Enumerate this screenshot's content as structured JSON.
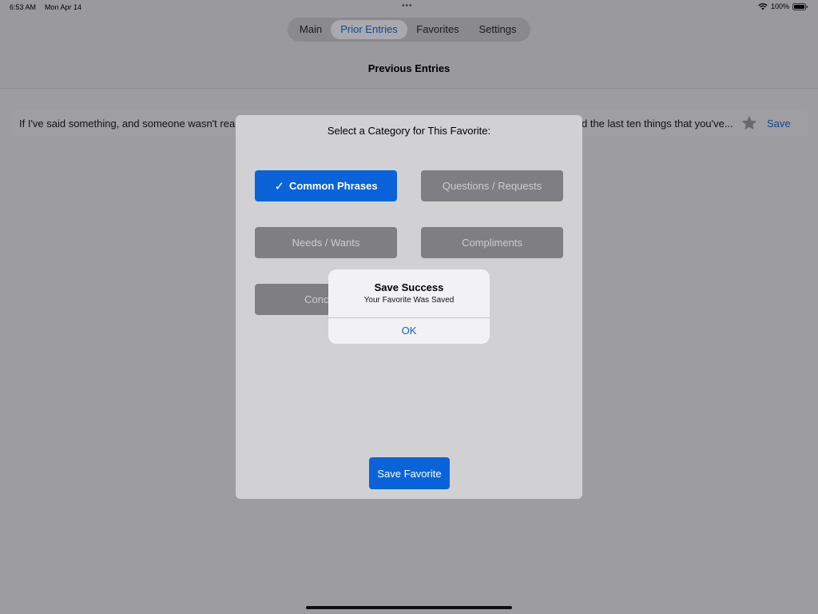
{
  "status_bar": {
    "time": "6:53 AM",
    "date": "Mon Apr 14",
    "dots": "•••",
    "battery": "100%",
    "icons": [
      "wifi-icon",
      "battery-icon"
    ]
  },
  "tabs": [
    {
      "label": "Main",
      "active": false
    },
    {
      "label": "Prior Entries",
      "active": true
    },
    {
      "label": "Favorites",
      "active": false
    },
    {
      "label": "Settings",
      "active": false
    }
  ],
  "page": {
    "title": "Previous Entries"
  },
  "entry": {
    "text_left": "If I've said something, and someone wasn't reall",
    "text_right": "d the last ten things that you've...",
    "star_icon": "star-icon",
    "save_label": "Save"
  },
  "modal": {
    "title": "Select a Category for This Favorite:",
    "categories": [
      {
        "label": "Common Phrases",
        "selected": true,
        "check": "✓"
      },
      {
        "label": "Questions / Requests",
        "selected": false
      },
      {
        "label": "Needs / Wants",
        "selected": false
      },
      {
        "label": "Compliments",
        "selected": false
      },
      {
        "label": "Conc",
        "selected": false
      }
    ],
    "save_button": "Save Favorite"
  },
  "alert": {
    "title": "Save Success",
    "message": "Your Favorite Was Saved",
    "ok": "OK"
  },
  "colors": {
    "accent": "#0a63d8",
    "link": "#0a4a9a",
    "overlay_bg": "#9d9da0",
    "modal_bg": "#d1d1d3",
    "category_bg": "#7f7f83"
  }
}
